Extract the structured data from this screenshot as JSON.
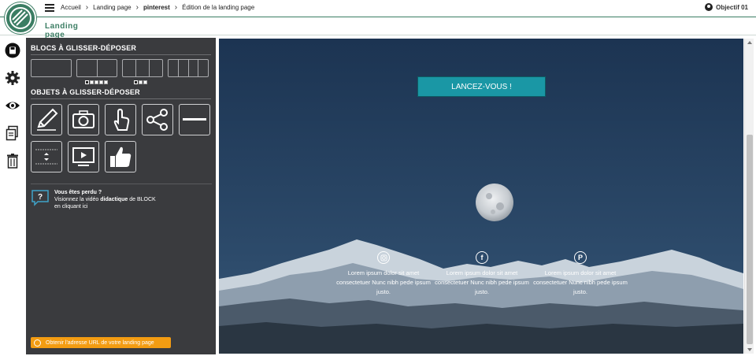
{
  "header": {
    "breadcrumb": [
      "Accueil",
      "Landing page",
      "pinterest",
      "Édition de la landing page"
    ],
    "user": "Objectif 01"
  },
  "tabs": {
    "active": "Landing page"
  },
  "toolstrip": [
    "save-icon",
    "gear-icon",
    "eye-icon",
    "duplicate-icon",
    "trash-icon"
  ],
  "panel": {
    "blocks_title": "BLOCS À GLISSER-DÉPOSER",
    "objects_title": "OBJETS À GLISSER-DÉPOSER",
    "help_line1": "Vous êtes perdu ?",
    "help_line2a": "Visionnez la vidéo ",
    "help_line2b": "didactique",
    "help_line2c": " de BLOCK",
    "help_line3": "en cliquant ici",
    "url_button": "Obtenir l'adresse URL de votre landing page"
  },
  "preview": {
    "cta": "LANCEZ-VOUS !",
    "social": [
      {
        "icon": "instagram-icon",
        "text": "Lorem ipsum dolor sit amet consectetuer Nunc nibh pede ipsum justo."
      },
      {
        "icon": "facebook-icon",
        "text": "Lorem ipsum dolor sit amet consectetuer Nunc nibh pede ipsum justo."
      },
      {
        "icon": "pinterest-icon",
        "text": "Lorem ipsum dolor sit amet consectetuer Nunc nibh pede ipsum justo."
      }
    ]
  },
  "colors": {
    "brand": "#3b7d63",
    "panel": "#3a3b3e",
    "cta": "#1a97a5",
    "url_button": "#f39c12"
  }
}
